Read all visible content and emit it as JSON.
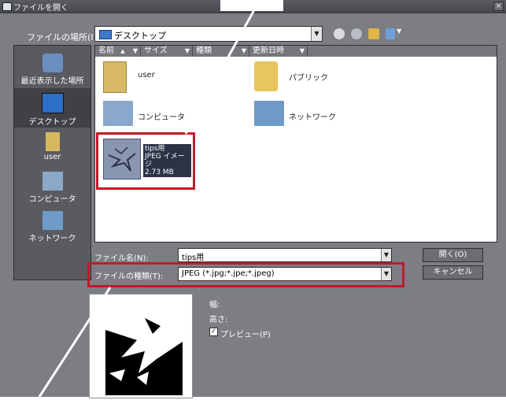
{
  "window": {
    "title": "ファイルを開く",
    "close_glyph": "×"
  },
  "location": {
    "label": "ファイルの場所(I):",
    "value": "デスクトップ"
  },
  "columns": [
    {
      "label": "名前",
      "sort": "▲"
    },
    {
      "label": "サイズ"
    },
    {
      "label": "種類"
    },
    {
      "label": "更新日時"
    }
  ],
  "places": [
    {
      "label": "最近表示した場所",
      "icon": "recent-places-icon"
    },
    {
      "label": "デスクトップ",
      "icon": "desktop-icon",
      "selected": true
    },
    {
      "label": "user",
      "icon": "user-folder-icon"
    },
    {
      "label": "コンピュータ",
      "icon": "computer-icon"
    },
    {
      "label": "ネットワーク",
      "icon": "network-icon"
    }
  ],
  "files": [
    {
      "name": "user",
      "icon": "user-folder-icon"
    },
    {
      "name": "パブリック",
      "icon": "folder-icon"
    },
    {
      "name": "コンピュータ",
      "icon": "computer-icon"
    },
    {
      "name": "ネットワーク",
      "icon": "network-icon"
    }
  ],
  "selected_file": {
    "line1": "tips用",
    "line2": "JPEG イメージ",
    "line3": "2.73 MB"
  },
  "filename": {
    "label": "ファイル名(N):",
    "value": "tips用"
  },
  "filetype": {
    "label": "ファイルの種類(T):",
    "value": "JPEG (*.jpg;*.jpe;*.jpeg)"
  },
  "buttons": {
    "open": "開く(O)",
    "cancel": "キャンセル"
  },
  "preview": {
    "width_label": "幅:",
    "height_label": "高さ:",
    "preview_label": "プレビュー(P)",
    "checked": true
  },
  "colors": {
    "highlight": "#c11a2a",
    "dialog_bg": "#7c7e84"
  }
}
